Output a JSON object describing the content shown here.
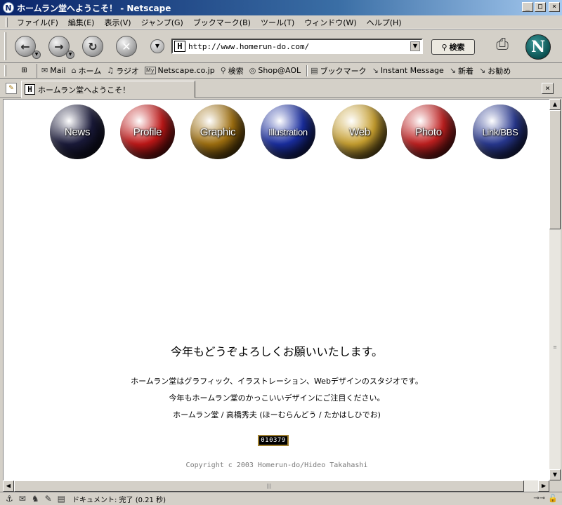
{
  "window": {
    "title": "ホームラン堂へようこそ！ - Netscape",
    "app_icon": "N",
    "min": "_",
    "max": "□",
    "close": "×"
  },
  "menu": [
    "ファイル(F)",
    "編集(E)",
    "表示(V)",
    "ジャンプ(G)",
    "ブックマーク(B)",
    "ツール(T)",
    "ウィンドウ(W)",
    "ヘルプ(H)"
  ],
  "nav": {
    "url": "http://www.homerun-do.com/",
    "url_favicon": "H",
    "search_label": "検索",
    "logo": "N"
  },
  "personal_toolbar": {
    "tabs_toggle": "⊞",
    "items": [
      {
        "icon": "mail-icon",
        "glyph": "✉",
        "label": "Mail"
      },
      {
        "icon": "home-icon",
        "glyph": "⌂",
        "label": "ホーム"
      },
      {
        "icon": "radio-icon",
        "glyph": "♫",
        "label": "ラジオ"
      },
      {
        "icon": "my-netscape-icon",
        "glyph": "My",
        "label": "Netscape.co.jp"
      },
      {
        "icon": "search-icon",
        "glyph": "⚲",
        "label": "検索"
      },
      {
        "icon": "shop-icon",
        "glyph": "◎",
        "label": "Shop@AOL"
      }
    ],
    "items2": [
      {
        "icon": "bookmark-icon",
        "glyph": "▤",
        "label": "ブックマーク"
      },
      {
        "icon": "instant-message-icon",
        "glyph": "↘",
        "label": "Instant Message"
      },
      {
        "icon": "new-icon",
        "glyph": "↘",
        "label": "新着"
      },
      {
        "icon": "recommend-icon",
        "glyph": "↘",
        "label": "お勧め"
      }
    ]
  },
  "tab": {
    "title": "ホームラン堂へようこそ！",
    "favicon": "H",
    "close": "×"
  },
  "page": {
    "nav_balls": [
      {
        "label": "News",
        "color": "#1a1a3a"
      },
      {
        "label": "Profile",
        "color": "#c01818"
      },
      {
        "label": "Graphic",
        "color": "#a07010"
      },
      {
        "label": "Illustration",
        "color": "#1a2ea0"
      },
      {
        "label": "Web",
        "color": "#c8a030"
      },
      {
        "label": "Photo",
        "color": "#c02020"
      },
      {
        "label": "Link/BBS",
        "color": "#283890"
      }
    ],
    "greeting": "今年もどうぞよろしくお願いいたします。",
    "line1": "ホームラン堂はグラフィック、イラストレーション、Webデザインのスタジオです。",
    "line2": "今年もホームラン堂のかっこいいデザインにご注目ください。",
    "line3": "ホームラン堂 / 高橋秀夫 (ほーむらんどう / たかはしひでお)",
    "counter": "010379",
    "copyright": "Copyright c 2003 Homerun-do/Hideo Takahashi"
  },
  "status": {
    "text": "ドキュメント: 完了 (0.21 秒)"
  }
}
